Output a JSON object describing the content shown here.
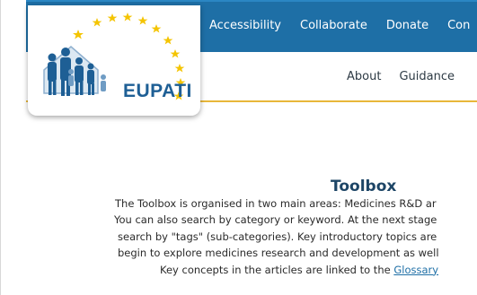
{
  "header": {
    "top_nav": [
      "Accessibility",
      "Collaborate",
      "Donate",
      "Con"
    ],
    "sub_nav": [
      "About",
      "Guidance"
    ],
    "logo_text": "EUPATI"
  },
  "main": {
    "heading": "Toolbox",
    "lines": [
      "The Toolbox is organised in two main areas: Medicines R&D ar",
      "You can also search by category or keyword. At the next stage",
      "search by \"tags\" (sub-categories). Key introductory topics are",
      "begin to explore medicines research and development as well",
      "Key concepts in the articles are linked to the "
    ],
    "glossary_link": "Glossary"
  },
  "colors": {
    "brand_blue": "#1e6fa6",
    "gold": "#e8b73a",
    "star_yellow": "#f4c400"
  }
}
